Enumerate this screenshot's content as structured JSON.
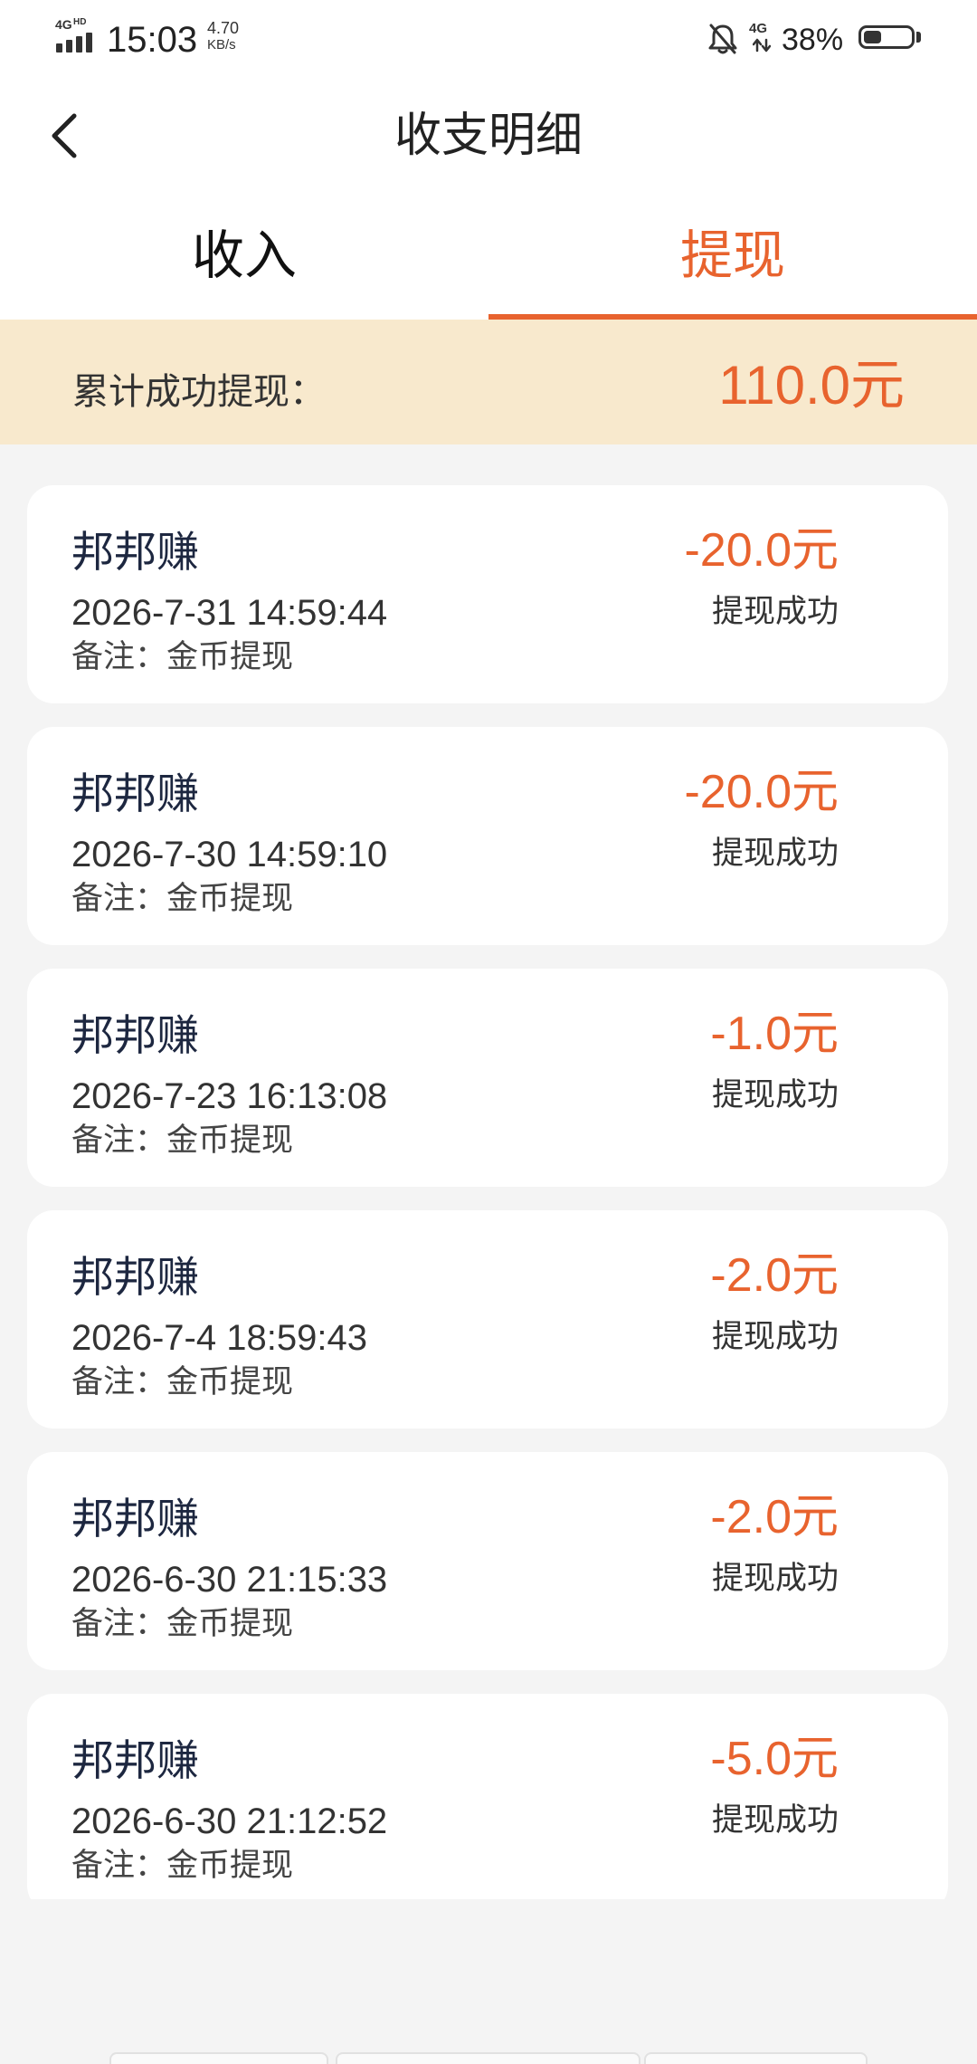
{
  "colors": {
    "accent": "#e8632e",
    "summary_bg": "#f8e9cd",
    "page_bg": "#f4f4f4",
    "card_title": "#1d2740"
  },
  "icons": {
    "back": "chevron-left-icon",
    "signal": "signal-bars-icon",
    "mute": "bell-off-icon",
    "network_activity": "updown-arrows-icon",
    "battery": "battery-icon"
  },
  "status_bar": {
    "signal_label": "4G",
    "signal_hd": "HD",
    "time": "15:03",
    "speed_value": "4.70",
    "speed_unit": "KB/s",
    "network": "4G",
    "battery_percent": "38%",
    "battery_level": 0.38
  },
  "header": {
    "title": "收支明细"
  },
  "tabs": [
    {
      "label": "收入",
      "active": false
    },
    {
      "label": "提现",
      "active": true
    }
  ],
  "summary": {
    "label": "累计成功提现：",
    "amount": "110.0元"
  },
  "records": [
    {
      "name": "邦邦赚",
      "time": "2026-7-31 14:59:44",
      "remark": "备注：金币提现",
      "amount": "-20.0元",
      "status": "提现成功"
    },
    {
      "name": "邦邦赚",
      "time": "2026-7-30 14:59:10",
      "remark": "备注：金币提现",
      "amount": "-20.0元",
      "status": "提现成功"
    },
    {
      "name": "邦邦赚",
      "time": "2026-7-23 16:13:08",
      "remark": "备注：金币提现",
      "amount": "-1.0元",
      "status": "提现成功"
    },
    {
      "name": "邦邦赚",
      "time": "2026-7-4 18:59:43",
      "remark": "备注：金币提现",
      "amount": "-2.0元",
      "status": "提现成功"
    },
    {
      "name": "邦邦赚",
      "time": "2026-6-30 21:15:33",
      "remark": "备注：金币提现",
      "amount": "-2.0元",
      "status": "提现成功"
    },
    {
      "name": "邦邦赚",
      "time": "2026-6-30 21:12:52",
      "remark": "备注：金币提现",
      "amount": "-5.0元",
      "status": "提现成功"
    }
  ]
}
